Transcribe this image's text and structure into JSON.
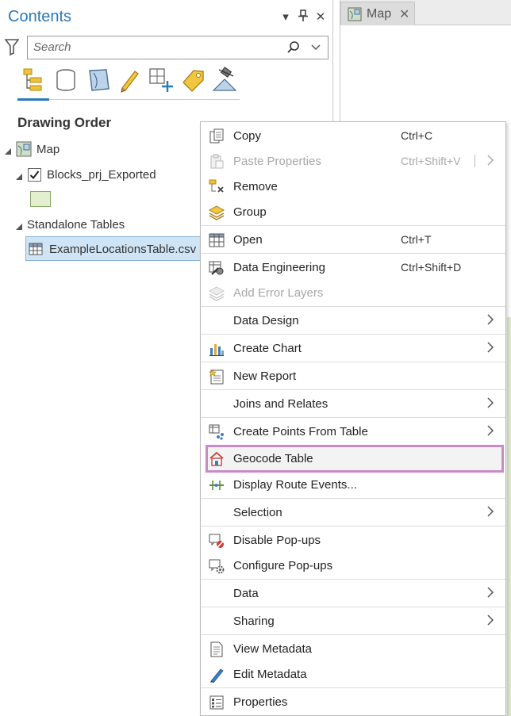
{
  "contents_pane": {
    "title": "Contents",
    "controls": {
      "dropdown": "▾",
      "pin": "⊤",
      "close": "✕"
    },
    "search": {
      "placeholder": "Search",
      "value": ""
    },
    "toolbar_icons": [
      "drawing-order-icon",
      "data-source-icon",
      "selection-icon",
      "editing-icon",
      "snapping-icon",
      "labeling-icon",
      "perspective-imagery-icon"
    ],
    "section_title": "Drawing Order",
    "tree": {
      "map": "Map",
      "layer": "Blocks_prj_Exported",
      "layer_checked": true,
      "standalone_tables": "Standalone Tables",
      "table": "ExampleLocationsTable.csv"
    }
  },
  "map_view": {
    "tab_label": "Map",
    "tab_close": "✕"
  },
  "context_menu": {
    "items": [
      {
        "label": "Copy",
        "shortcut": "Ctrl+C",
        "icon": "copy-icon",
        "disabled": false
      },
      {
        "label": "Paste Properties",
        "shortcut": "Ctrl+Shift+V",
        "icon": "paste-icon",
        "disabled": true,
        "submenu": true
      },
      {
        "label": "Remove",
        "shortcut": "",
        "icon": "remove-icon",
        "disabled": false
      },
      {
        "label": "Group",
        "shortcut": "",
        "icon": "group-icon",
        "disabled": false
      },
      {
        "label": "Open",
        "shortcut": "Ctrl+T",
        "icon": "table-icon",
        "disabled": false
      },
      {
        "label": "Data Engineering",
        "shortcut": "Ctrl+Shift+D",
        "icon": "data-engineering-icon",
        "disabled": false
      },
      {
        "label": "Add Error Layers",
        "shortcut": "",
        "icon": "error-layers-icon",
        "disabled": true
      },
      {
        "label": "Data Design",
        "shortcut": "",
        "icon": "",
        "disabled": false,
        "submenu": true
      },
      {
        "label": "Create Chart",
        "shortcut": "",
        "icon": "chart-icon",
        "disabled": false,
        "submenu": true
      },
      {
        "label": "New Report",
        "shortcut": "",
        "icon": "report-icon",
        "disabled": false
      },
      {
        "label": "Joins and Relates",
        "shortcut": "",
        "icon": "",
        "disabled": false,
        "submenu": true
      },
      {
        "label": "Create Points From Table",
        "shortcut": "",
        "icon": "points-icon",
        "disabled": false,
        "submenu": true
      },
      {
        "label": "Geocode Table",
        "shortcut": "",
        "icon": "geocode-icon",
        "disabled": false,
        "highlighted": true
      },
      {
        "label": "Display Route Events...",
        "shortcut": "",
        "icon": "route-events-icon",
        "disabled": false
      },
      {
        "label": "Selection",
        "shortcut": "",
        "icon": "",
        "disabled": false,
        "submenu": true
      },
      {
        "label": "Disable Pop-ups",
        "shortcut": "",
        "icon": "disable-popups-icon",
        "disabled": false
      },
      {
        "label": "Configure Pop-ups",
        "shortcut": "",
        "icon": "configure-popups-icon",
        "disabled": false
      },
      {
        "label": "Data",
        "shortcut": "",
        "icon": "",
        "disabled": false,
        "submenu": true
      },
      {
        "label": "Sharing",
        "shortcut": "",
        "icon": "",
        "disabled": false,
        "submenu": true
      },
      {
        "label": "View Metadata",
        "shortcut": "",
        "icon": "view-metadata-icon",
        "disabled": false
      },
      {
        "label": "Edit Metadata",
        "shortcut": "",
        "icon": "edit-metadata-icon",
        "disabled": false
      },
      {
        "label": "Properties",
        "shortcut": "",
        "icon": "properties-icon",
        "disabled": false
      }
    ]
  },
  "colors": {
    "accent": "#2a7ab8",
    "selection_fill": "#cfe4f5",
    "highlight_border": "#c98ac7",
    "disabled_text": "#a8a8a8"
  }
}
